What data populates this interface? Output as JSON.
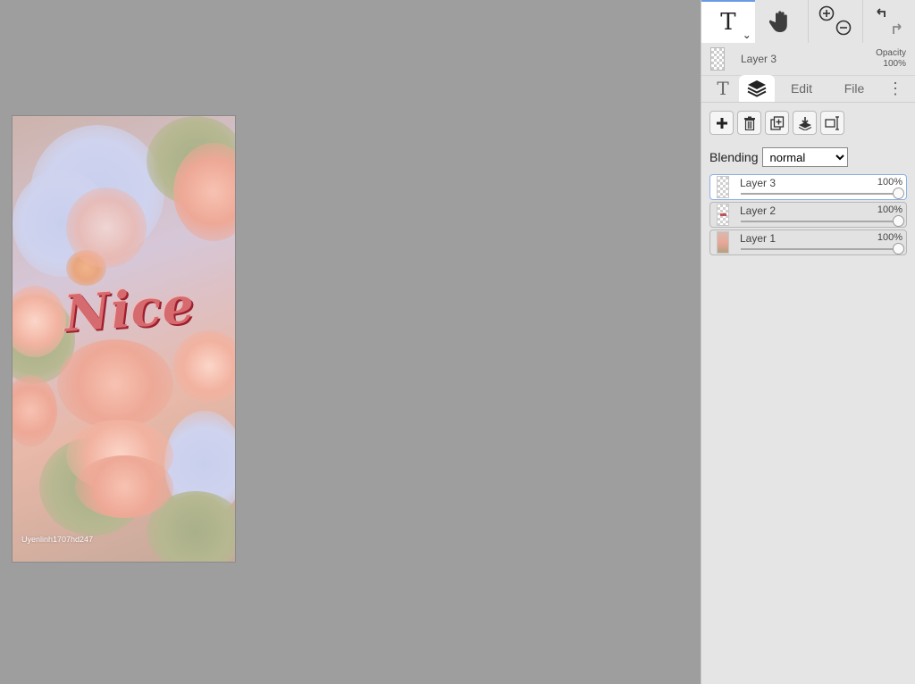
{
  "canvas": {
    "text": "Nice",
    "watermark": "Uyenlinh1707hd247"
  },
  "toolbar": {
    "icons": [
      "text-tool-icon",
      "hand-icon",
      "zoom-in-icon",
      "zoom-out-icon",
      "undo-icon",
      "redo-icon"
    ],
    "text_tool_glyph": "T",
    "caret_glyph": "⌄"
  },
  "current_layer": {
    "name": "Layer 3",
    "opacity_label": "Opacity",
    "opacity_value": "100%"
  },
  "tabs": {
    "text_glyph": "T",
    "edit": "Edit",
    "file": "File",
    "more": "⋮"
  },
  "actions": [
    "add-layer",
    "delete-layer",
    "duplicate-layer",
    "merge-down",
    "layer-properties"
  ],
  "blending": {
    "label": "Blending",
    "selected": "normal"
  },
  "layers": [
    {
      "name": "Layer 3",
      "opacity": "100%",
      "opacity_fraction": 1.0,
      "active": true
    },
    {
      "name": "Layer 2",
      "opacity": "100%",
      "opacity_fraction": 1.0,
      "active": false
    },
    {
      "name": "Layer 1",
      "opacity": "100%",
      "opacity_fraction": 1.0,
      "active": false
    }
  ],
  "colors": {
    "accent": "#6a9be6",
    "workspace": "#9e9e9e",
    "panel": "#e5e5e5",
    "text_fill": "#d56a6f",
    "text_outline": "#9e1f2c"
  }
}
